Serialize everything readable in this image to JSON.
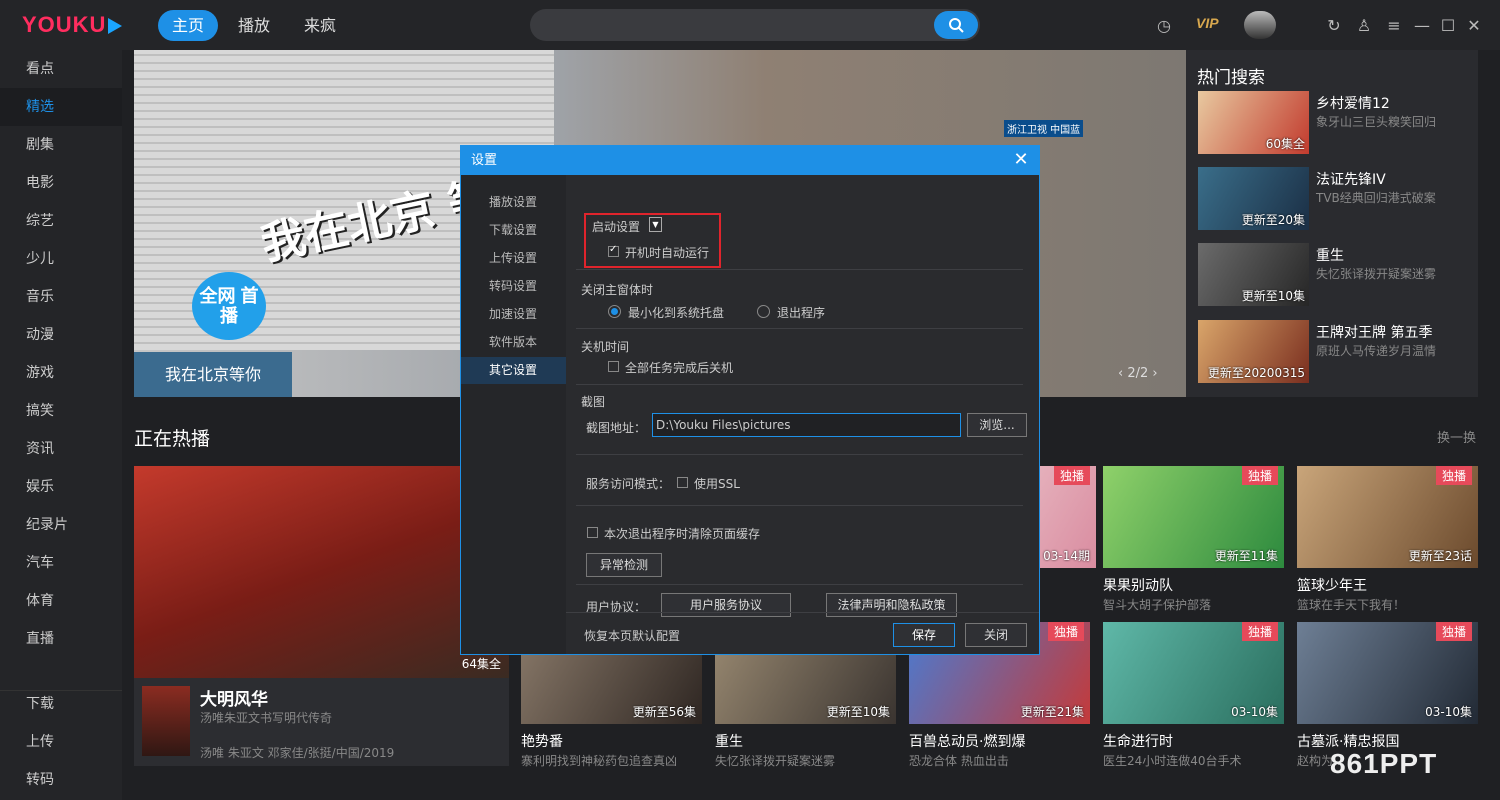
{
  "app": {
    "logo": "YOUKU",
    "nav_tabs": [
      "主页",
      "播放",
      "来疯"
    ],
    "vip_label": "VIP",
    "icons": [
      "history-icon",
      "refresh-icon",
      "skin-icon",
      "menu-icon",
      "minimize-icon",
      "maximize-icon",
      "close-icon"
    ]
  },
  "sidebar": {
    "items": [
      "看点",
      "精选",
      "剧集",
      "电影",
      "综艺",
      "少儿",
      "音乐",
      "动漫",
      "游戏",
      "搞笑",
      "资讯",
      "娱乐",
      "纪录片",
      "汽车",
      "体育",
      "直播"
    ],
    "active_index": 1,
    "bottom_items": [
      "下载",
      "上传",
      "转码"
    ]
  },
  "banner": {
    "calligraphy": "我在北京 等你",
    "badge": "全网 首播",
    "caption": "我在北京等你",
    "pager": "2/2"
  },
  "hot_search": {
    "title": "热门搜索",
    "items": [
      {
        "name": "乡村爱情12",
        "desc": "象牙山三巨头糗笑回归",
        "ep": "60集全"
      },
      {
        "name": "法证先锋IV",
        "desc": "TVB经典回归港式破案",
        "ep": "更新至20集"
      },
      {
        "name": "重生",
        "desc": "失忆张译拨开疑案迷雾",
        "ep": "更新至10集"
      },
      {
        "name": "王牌对王牌 第五季",
        "desc": "原班人马传递岁月温情",
        "ep": "更新至20200315"
      }
    ]
  },
  "section": {
    "title": "正在热播",
    "swap_label": "换一换"
  },
  "feature": {
    "name": "大明风华",
    "desc": "汤唯朱亚文书写明代传奇",
    "cast": "汤唯 朱亚文 邓家佳/张挺/中国/2019",
    "ep": "64集全"
  },
  "cards_row1": [
    {
      "name": "",
      "desc": "",
      "ep": "03-14期",
      "badge": "独播"
    },
    {
      "name": "果果别动队",
      "desc": "智斗大胡子保护部落",
      "ep": "更新至11集",
      "badge": "独播"
    },
    {
      "name": "篮球少年王",
      "desc": "篮球在手天下我有！",
      "ep": "更新至23话",
      "badge": "独播"
    }
  ],
  "cards_row2": [
    {
      "name": "艳势番",
      "desc": "寨利明找到神秘药包追查真凶",
      "ep": "更新至56集",
      "badge": ""
    },
    {
      "name": "重生",
      "desc": "失忆张译拨开疑案迷雾",
      "ep": "更新至10集",
      "badge": ""
    },
    {
      "name": "百兽总动员·燃到爆",
      "desc": "恐龙合体 热血出击",
      "ep": "更新至21集",
      "badge": "独播"
    },
    {
      "name": "生命进行时",
      "desc": "医生24小时连做40台手术",
      "ep": "03-10集",
      "badge": "独播"
    },
    {
      "name": "古墓派·精忠报国",
      "desc": "赵构为...",
      "ep": "03-10集",
      "badge": "独播"
    }
  ],
  "watermark": "861PPT",
  "dialog": {
    "title": "设置",
    "nav": [
      "播放设置",
      "下载设置",
      "上传设置",
      "转码设置",
      "加速设置",
      "软件版本",
      "其它设置"
    ],
    "active_nav": 6,
    "startup": {
      "label": "启动设置",
      "autorun": "开机时自动运行",
      "autorun_checked": true
    },
    "close_main": {
      "label": "关闭主窗体时",
      "opt_minimize": "最小化到系统托盘",
      "opt_exit": "退出程序",
      "selected": "minimize"
    },
    "shutdown": {
      "label": "关机时间",
      "opt": "全部任务完成后关机",
      "checked": false
    },
    "screenshot": {
      "label": "截图",
      "path_label": "截图地址：",
      "path_value": "D:\\Youku Files\\pictures",
      "browse": "浏览..."
    },
    "service": {
      "label": "服务访问模式：",
      "ssl": "使用SSL",
      "checked": false
    },
    "clear_cache": {
      "label": "本次退出程序时清除页面缓存",
      "checked": false
    },
    "anomaly_btn": "异常检测",
    "agreement": {
      "label": "用户协议：",
      "btn_service": "用户服务协议",
      "btn_legal": "法律声明和隐私政策"
    },
    "restore": "恢复本页默认配置",
    "save": "保存",
    "close": "关闭"
  }
}
